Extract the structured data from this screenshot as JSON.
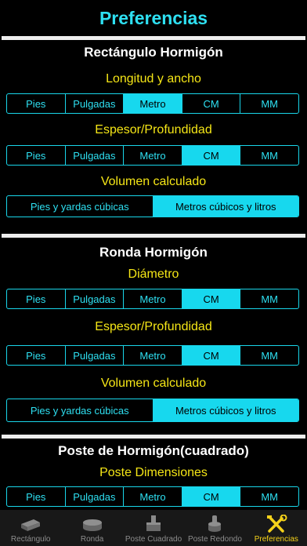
{
  "header": {
    "title": "Preferencias"
  },
  "sections": [
    {
      "title": "Rectángulo Hormigón",
      "groups": [
        {
          "label": "Longitud y ancho",
          "options": [
            "Pies",
            "Pulgadas",
            "Metro",
            "CM",
            "MM"
          ],
          "selected": "Metro"
        },
        {
          "label": "Espesor/Profundidad",
          "options": [
            "Pies",
            "Pulgadas",
            "Metro",
            "CM",
            "MM"
          ],
          "selected": "CM"
        },
        {
          "label": "Volumen calculado",
          "options": [
            "Pies y yardas cúbicas",
            "Metros cúbicos y litros"
          ],
          "selected": "Metros cúbicos y litros"
        }
      ]
    },
    {
      "title": "Ronda Hormigón",
      "groups": [
        {
          "label": "Diámetro",
          "options": [
            "Pies",
            "Pulgadas",
            "Metro",
            "CM",
            "MM"
          ],
          "selected": "CM"
        },
        {
          "label": "Espesor/Profundidad",
          "options": [
            "Pies",
            "Pulgadas",
            "Metro",
            "CM",
            "MM"
          ],
          "selected": "CM"
        },
        {
          "label": "Volumen calculado",
          "options": [
            "Pies y yardas cúbicas",
            "Metros cúbicos y litros"
          ],
          "selected": "Pies y yardas cúbicas"
        }
      ]
    },
    {
      "title": "Poste de Hormigón(cuadrado)",
      "groups": [
        {
          "label": "Poste Dimensiones",
          "options": [
            "Pies",
            "Pulgadas",
            "Metro",
            "CM",
            "MM"
          ],
          "selected": "CM"
        }
      ]
    }
  ],
  "tabbar": {
    "items": [
      {
        "label": "Rectángulo",
        "icon": "slab-icon"
      },
      {
        "label": "Ronda",
        "icon": "round-slab-icon"
      },
      {
        "label": "Poste Cuadrado",
        "icon": "square-post-icon"
      },
      {
        "label": "Poste Redondo",
        "icon": "round-post-icon"
      },
      {
        "label": "Preferencias",
        "icon": "tools-icon"
      }
    ],
    "active": "Preferencias"
  },
  "colors": {
    "accent": "#17d8ee",
    "label": "#f5e616",
    "active_tab": "#f5d21a"
  }
}
